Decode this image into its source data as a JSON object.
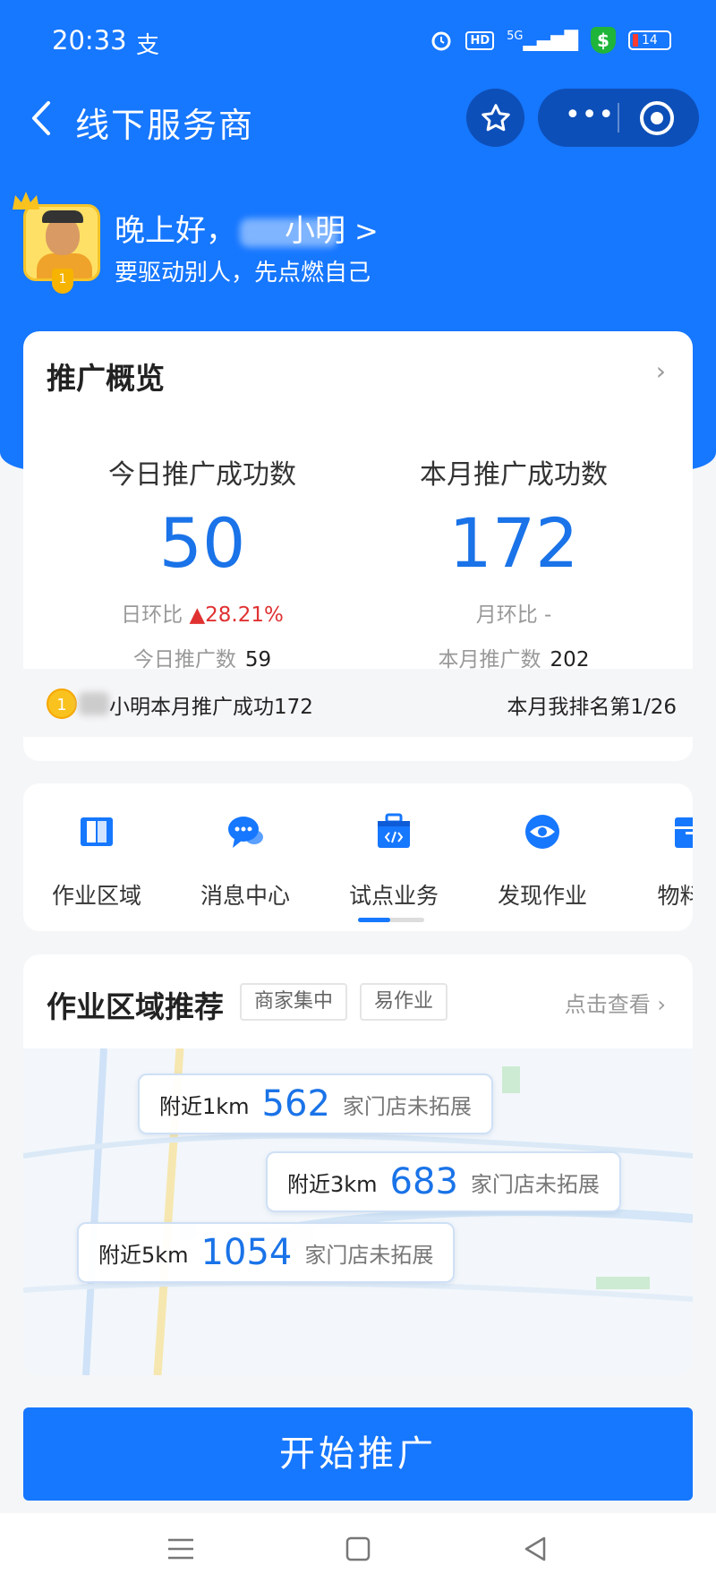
{
  "status_bar": {
    "time": "20:33",
    "app_indicator": "支",
    "hd_label": "HD",
    "network": "5G",
    "battery": "14"
  },
  "nav": {
    "title": "线下服务商"
  },
  "greeting": {
    "hello": "晚上好，",
    "name_visible": "小明",
    "motto": "要驱动别人，先点燃自己",
    "avatar_rank": "1"
  },
  "overview": {
    "title": "推广概览",
    "today": {
      "label": "今日推广成功数",
      "value": "50",
      "compare_label": "日环比",
      "compare_value": "28.21%",
      "total_label": "今日推广数",
      "total_value": "59"
    },
    "month": {
      "label": "本月推广成功数",
      "value": "172",
      "compare_label": "月环比",
      "compare_value": "-",
      "total_label": "本月推广数",
      "total_value": "202"
    },
    "rank_bar": {
      "medal": "1",
      "text": "小明本月推广成功172",
      "my_rank": "本月我排名第1/26"
    }
  },
  "menu": {
    "items": [
      {
        "label": "作业区域",
        "icon": "map-book-icon"
      },
      {
        "label": "消息中心",
        "icon": "chat-icon"
      },
      {
        "label": "试点业务",
        "icon": "code-case-icon"
      },
      {
        "label": "发现作业",
        "icon": "eye-icon"
      },
      {
        "label": "物料中",
        "icon": "box-icon"
      }
    ]
  },
  "area": {
    "title": "作业区域推荐",
    "tags": [
      "商家集中",
      "易作业"
    ],
    "view_link": "点击查看",
    "bubbles": [
      {
        "distance": "附近1km",
        "count": "562",
        "suffix": "家门店未拓展"
      },
      {
        "distance": "附近3km",
        "count": "683",
        "suffix": "家门店未拓展"
      },
      {
        "distance": "附近5km",
        "count": "1054",
        "suffix": "家门店未拓展"
      }
    ]
  },
  "cta": {
    "label": "开始推广"
  },
  "colors": {
    "brand_blue": "#1677ff",
    "number_blue": "#1a73e8",
    "up_red": "#e03131"
  }
}
